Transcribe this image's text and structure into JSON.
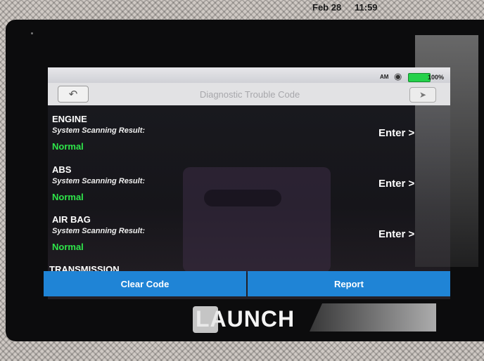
{
  "statusbar": {
    "date": "Feb 28",
    "time": "11:59",
    "ampm": "AM",
    "battery": "100%"
  },
  "titlebar": {
    "title": "Diagnostic Trouble Code",
    "back_icon": "back-arrow-icon",
    "exit_icon": "exit-icon"
  },
  "systems": [
    {
      "name": "ENGINE",
      "label": "System Scanning Result:",
      "status": "Normal",
      "enter": "Enter >"
    },
    {
      "name": "ABS",
      "label": "System Scanning Result:",
      "status": "Normal",
      "enter": "Enter >"
    },
    {
      "name": "AIR BAG",
      "label": "System Scanning Result:",
      "status": "Normal",
      "enter": "Enter >"
    },
    {
      "name": "TRANSMISSION"
    }
  ],
  "buttons": {
    "clear": "Clear Code",
    "report": "Report"
  },
  "brand": "LAUNCH",
  "colors": {
    "button_blue": "#1f84d6",
    "status_green": "#2ee64a",
    "battery_green": "#24d14a"
  }
}
